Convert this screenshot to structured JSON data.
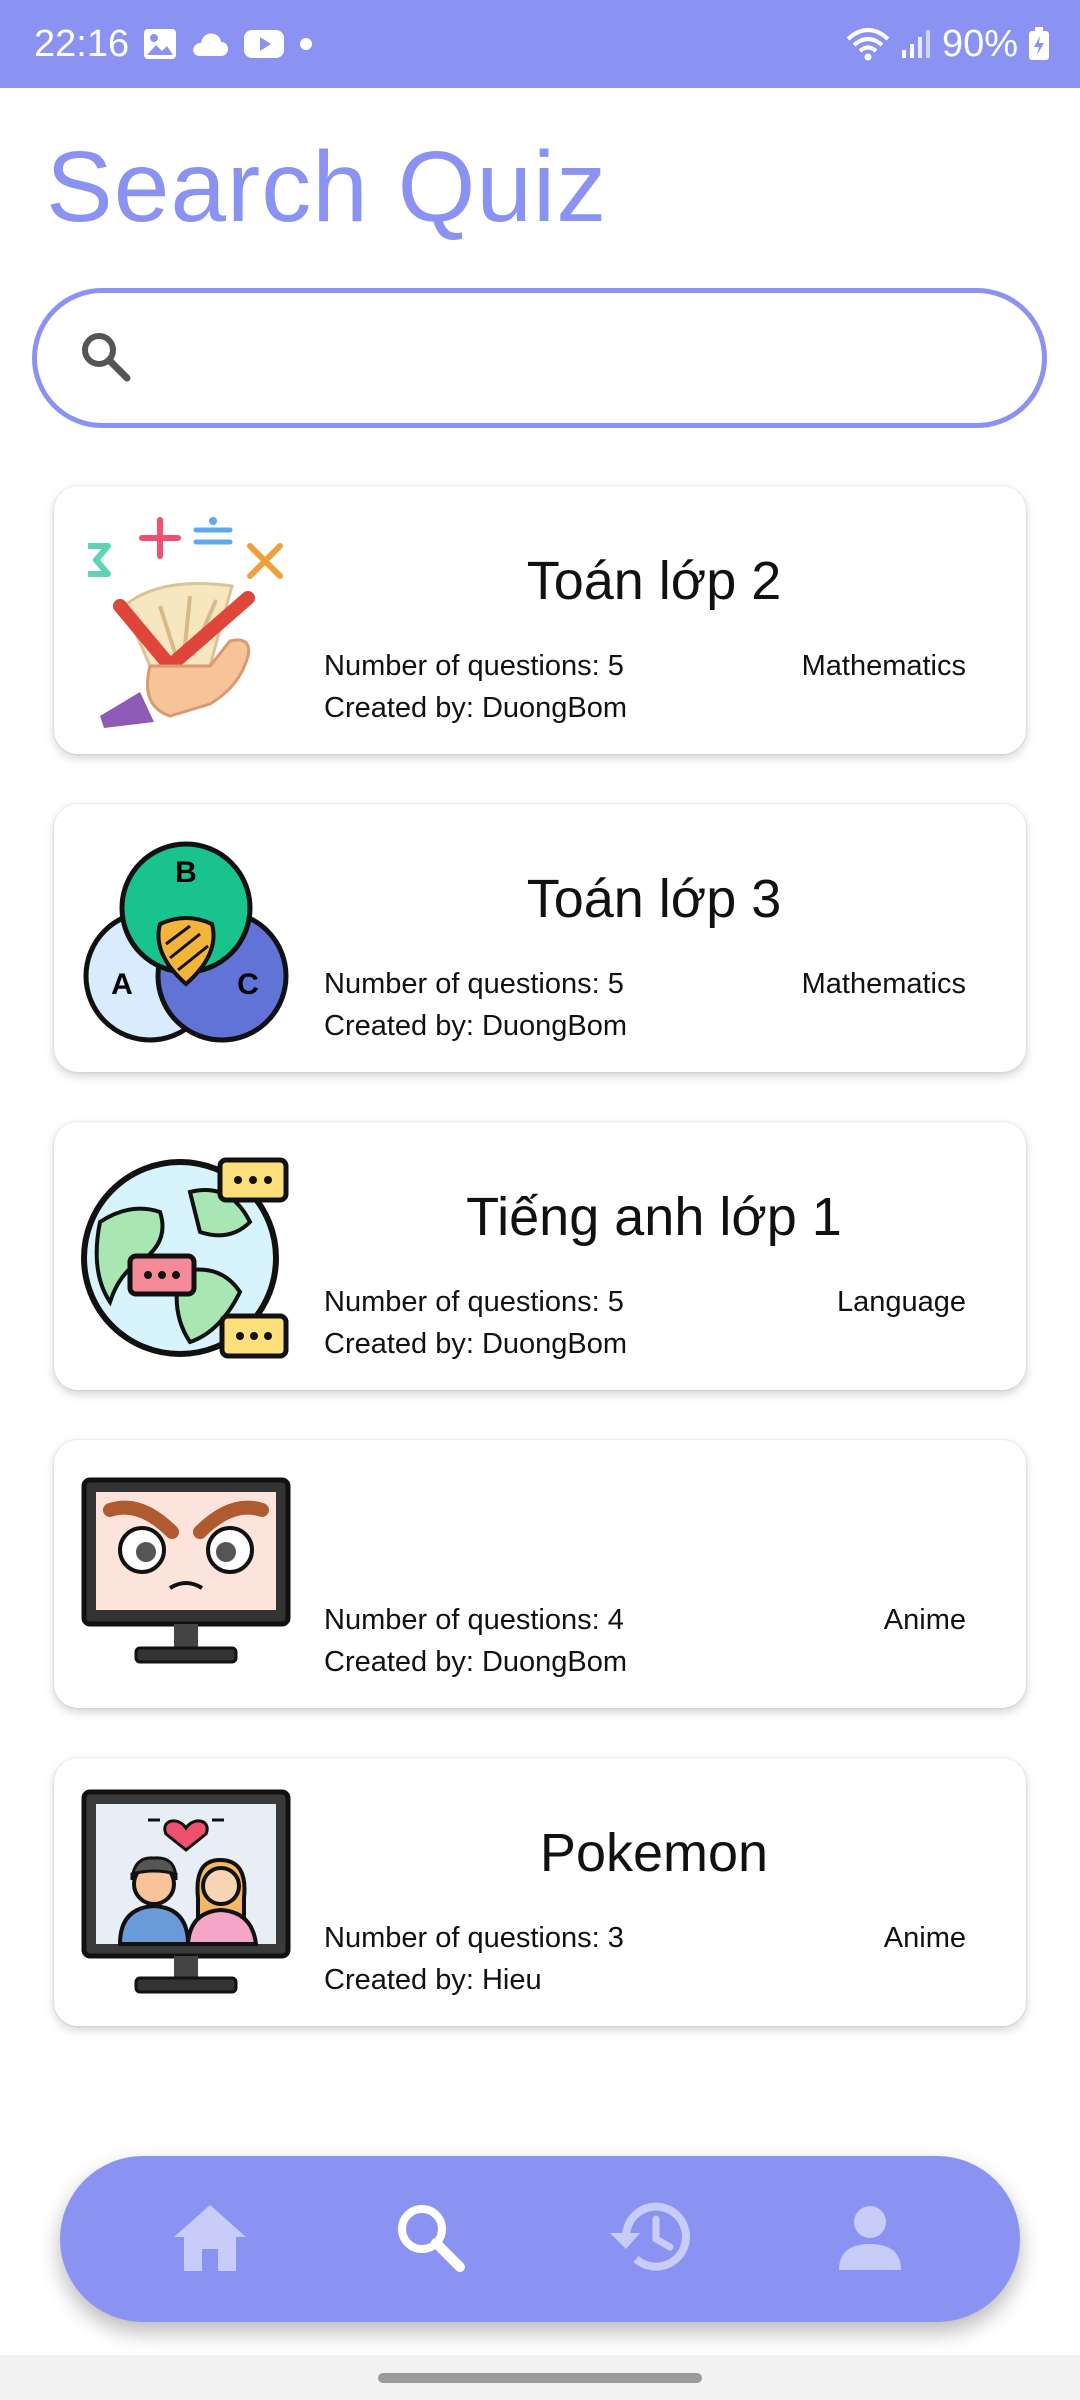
{
  "status_bar": {
    "time": "22:16",
    "battery": "90%",
    "icons": [
      "image-icon",
      "cloud-icon",
      "youtube-icon",
      "dot-icon",
      "wifi-icon",
      "signal-icon",
      "battery-icon"
    ]
  },
  "page": {
    "title": "Search Quiz"
  },
  "search": {
    "value": "",
    "placeholder": "",
    "icon": "search-icon"
  },
  "quizzes": [
    {
      "title": "Toán lớp 2",
      "questions": "Number of questions: 5",
      "category": "Mathematics",
      "author": "Created by: DuongBom",
      "icon": "math-symbols-icon"
    },
    {
      "title": "Toán lớp 3",
      "questions": "Number of questions: 5",
      "category": "Mathematics",
      "author": "Created by: DuongBom",
      "icon": "venn-diagram-icon"
    },
    {
      "title": "Tiếng anh lớp 1",
      "questions": "Number of questions: 5",
      "category": "Language",
      "author": "Created by: DuongBom",
      "icon": "globe-chat-icon"
    },
    {
      "title": "",
      "questions": "Number of questions: 4",
      "category": "Anime",
      "author": "Created by: DuongBom",
      "icon": "angry-monitor-icon"
    },
    {
      "title": "Pokemon",
      "questions": "Number of questions: 3",
      "category": "Anime",
      "author": "Created by: Hieu",
      "icon": "couple-monitor-icon"
    }
  ],
  "bottom_nav": {
    "items": [
      {
        "icon": "home-icon"
      },
      {
        "icon": "search-icon",
        "active": true
      },
      {
        "icon": "history-icon"
      },
      {
        "icon": "profile-icon"
      }
    ]
  },
  "colors": {
    "accent": "#8a93f2",
    "nav_inactive": "#c8ccf8",
    "nav_active": "#ffffff"
  }
}
